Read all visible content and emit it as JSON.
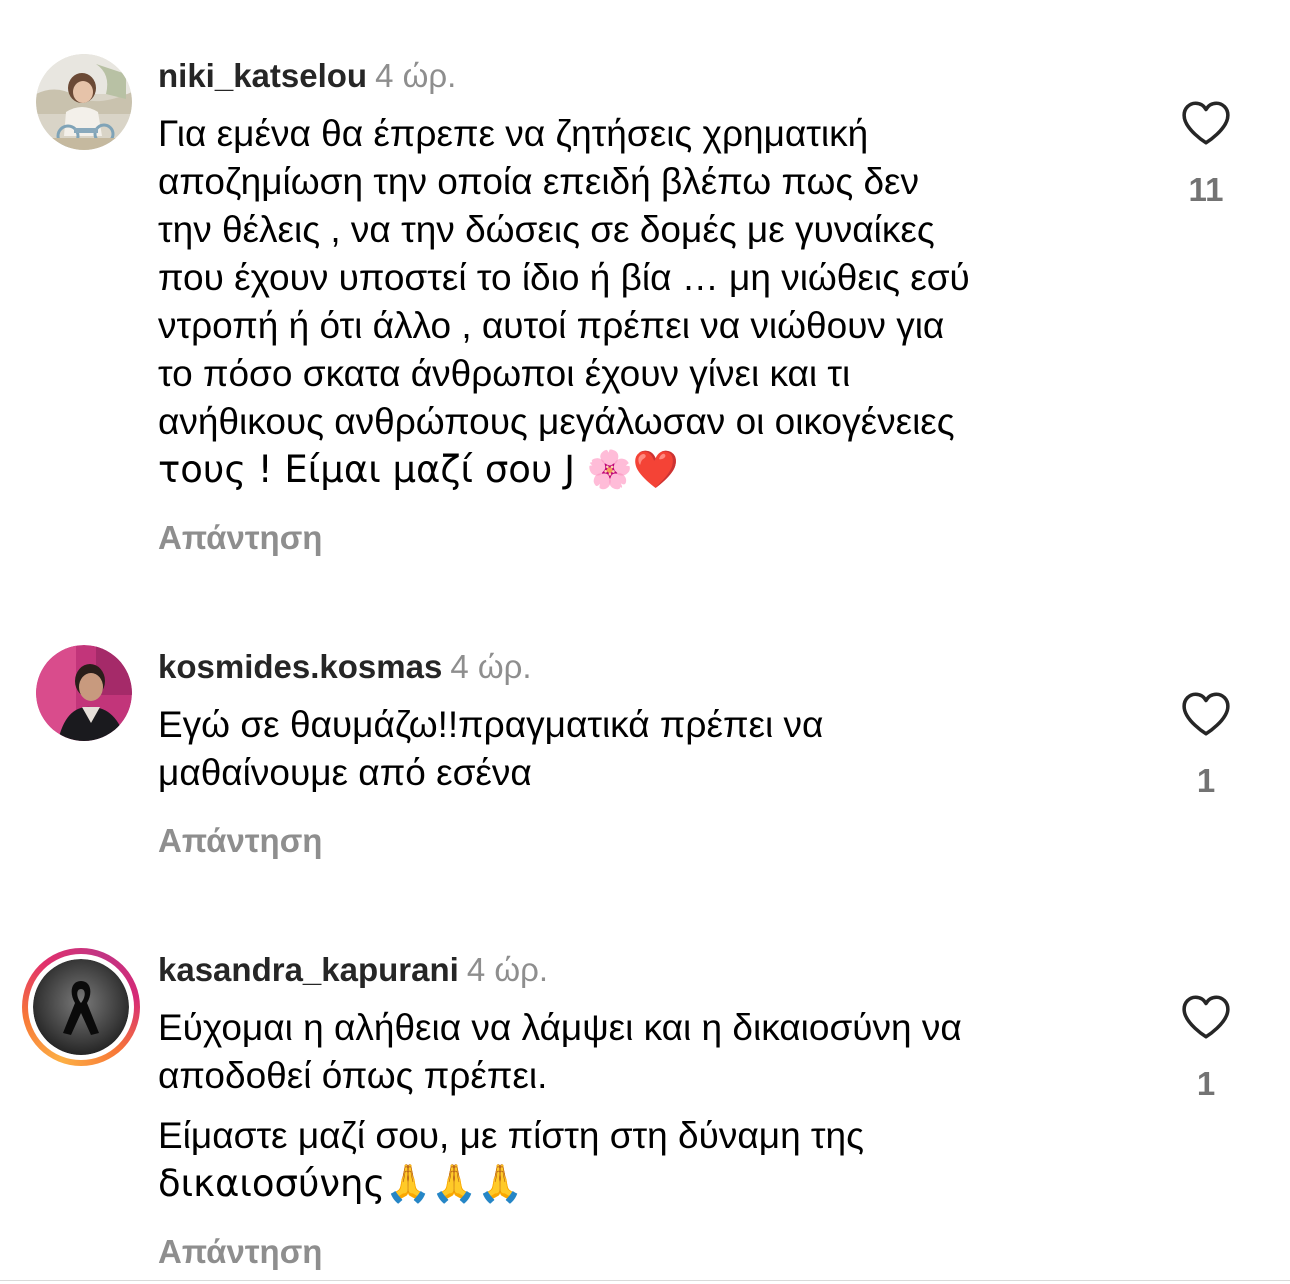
{
  "comments": [
    {
      "username": "niki_katselou",
      "time": "4 ώρ.",
      "lines": [
        "Για εμένα θα έπρεπε να ζητήσεις χρηματική",
        "αποζημίωση την οποία επειδή βλέπω πως δεν",
        "την θέλεις , να την δώσεις σε δομές με γυναίκες",
        "που έχουν υποστεί το ίδιο ή βία … μη νιώθεις εσύ",
        "ντροπή ή ότι άλλο , αυτοί πρέπει να νιώθουν για",
        "το πόσο σκατα άνθρωποι έχουν γίνει και τι",
        "ανήθικους ανθρώπους μεγάλωσαν οι οικογένειες",
        "τους ! Είμαι μαζί σου J 🌸❤️"
      ],
      "reply_label": "Απάντηση",
      "like_count": "11",
      "avatar_icon": "girl-photo-avatar"
    },
    {
      "username": "kosmides.kosmas",
      "time": "4 ώρ.",
      "lines": [
        "Εγώ σε θαυμάζω!!πραγματικά πρέπει να",
        "μαθαίνουμε από εσένα"
      ],
      "reply_label": "Απάντηση",
      "like_count": "1",
      "avatar_icon": "man-photo-avatar"
    },
    {
      "username": "kasandra_kapurani",
      "time": "4 ώρ.",
      "lines": [
        "Εύχομαι η αλήθεια να λάμψει και η δικαιοσύνη να",
        "αποδοθεί όπως πρέπει.",
        "Είμαστε μαζί σου, με πίστη στη δύναμη της",
        "δικαιοσύνης🙏🙏🙏"
      ],
      "reply_label": "Απάντηση",
      "like_count": "1",
      "avatar_icon": "black-ribbon-avatar",
      "has_story_ring": true
    }
  ],
  "colors": {
    "username": "#262626",
    "secondary_text": "#8e8e8e",
    "like_count": "#737373",
    "heart_outline": "#262626"
  }
}
